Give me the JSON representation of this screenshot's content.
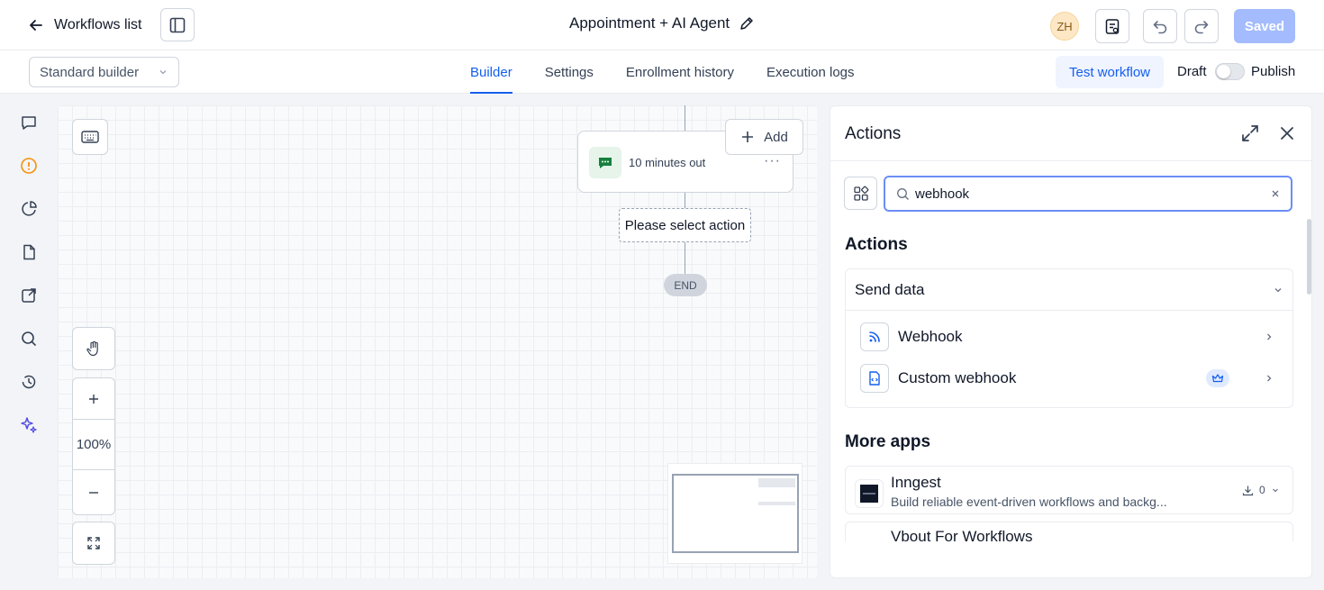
{
  "header": {
    "back_label": "Workflows list",
    "title": "Appointment + AI Agent",
    "avatar_initials": "ZH",
    "saved_label": "Saved"
  },
  "subbar": {
    "builder_select": "Standard builder",
    "tabs": [
      {
        "label": "Builder",
        "active": true
      },
      {
        "label": "Settings",
        "active": false
      },
      {
        "label": "Enrollment history",
        "active": false
      },
      {
        "label": "Execution logs",
        "active": false
      }
    ],
    "test_label": "Test workflow",
    "draft_label": "Draft",
    "publish_label": "Publish"
  },
  "sidenav": {
    "icons": [
      "chat-icon",
      "alert-circle-icon",
      "pie-chart-icon",
      "document-icon",
      "external-link-icon",
      "search-icon",
      "history-icon",
      "sparkle-icon"
    ]
  },
  "canvas": {
    "node_label": "10 minutes out",
    "add_label": "Add",
    "placeholder_label": "Please select action",
    "end_label": "END",
    "zoom_level": "100%"
  },
  "panel": {
    "title": "Actions",
    "search_value": "webhook",
    "section_actions": "Actions",
    "group": {
      "label": "Send data",
      "items": [
        {
          "label": "Webhook",
          "premium": false
        },
        {
          "label": "Custom webhook",
          "premium": true
        }
      ]
    },
    "section_more": "More apps",
    "apps": [
      {
        "name": "Inngest",
        "description": "Build reliable event-driven workflows and backg...",
        "installs": "0"
      },
      {
        "name": "Vbout For Workflows",
        "description": "",
        "installs": ""
      }
    ]
  },
  "colors": {
    "accent": "#155eef",
    "saved_bg": "#a4bcfd",
    "sparkle": "#4f46e5",
    "alert": "#f79009"
  }
}
